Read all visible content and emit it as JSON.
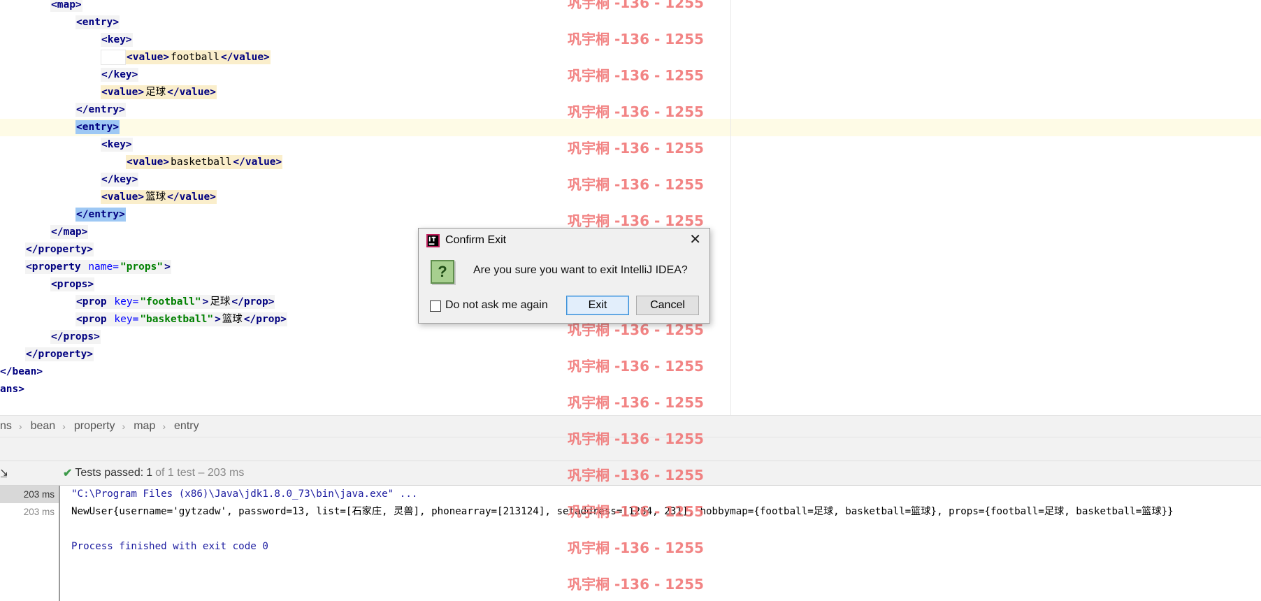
{
  "editor": {
    "lines": [
      {
        "indent": 72,
        "tokens": [
          [
            "bl hl-tag",
            "<map>"
          ]
        ]
      },
      {
        "indent": 108,
        "tokens": [
          [
            "bl hl-tag",
            "<entry>"
          ]
        ]
      },
      {
        "indent": 144,
        "tokens": [
          [
            "bl hl-tag",
            "<key>"
          ]
        ]
      },
      {
        "indent": 180,
        "pre": "white-block",
        "tokens": [
          [
            "hl-val",
            "<value>",
            "bl"
          ],
          [
            "hl-val",
            "football",
            "tx"
          ],
          [
            "hl-val",
            "</value>",
            "bl"
          ]
        ]
      },
      {
        "indent": 144,
        "tokens": [
          [
            "bl hl-tag",
            "</key>"
          ]
        ]
      },
      {
        "indent": 144,
        "tokens": [
          [
            "hl-val",
            "<value>",
            "bl"
          ],
          [
            "hl-val",
            "足球",
            "tx"
          ],
          [
            "hl-val",
            "</value>",
            "bl"
          ]
        ]
      },
      {
        "indent": 108,
        "tokens": [
          [
            "bl hl-tag",
            "</entry>"
          ]
        ]
      },
      {
        "indent": 108,
        "caret": true,
        "tokens": [
          [
            "bl hl-sel",
            "<entry>"
          ]
        ]
      },
      {
        "indent": 144,
        "tokens": [
          [
            "bl hl-tag",
            "<key>"
          ]
        ]
      },
      {
        "indent": 180,
        "tokens": [
          [
            "hl-val",
            "<value>",
            "bl"
          ],
          [
            "hl-val",
            "basketball",
            "tx"
          ],
          [
            "hl-val",
            "</value>",
            "bl"
          ]
        ]
      },
      {
        "indent": 144,
        "tokens": [
          [
            "bl hl-tag",
            "</key>"
          ]
        ]
      },
      {
        "indent": 144,
        "tokens": [
          [
            "hl-val",
            "<value>",
            "bl"
          ],
          [
            "hl-val",
            "篮球",
            "tx"
          ],
          [
            "hl-val",
            "</value>",
            "bl"
          ]
        ]
      },
      {
        "indent": 108,
        "tokens": [
          [
            "bl hl-sel",
            "</entry>"
          ]
        ]
      },
      {
        "indent": 72,
        "tokens": [
          [
            "bl hl-tag",
            "</map>"
          ]
        ]
      },
      {
        "indent": 36,
        "tokens": [
          [
            "bl hl-tag",
            "</property>"
          ]
        ]
      },
      {
        "indent": 36,
        "tokens": [
          [
            "bl hl-tag",
            "<property "
          ],
          [
            "at hl-tag",
            "name="
          ],
          [
            "vl hl-tag",
            "\"props\""
          ],
          [
            "bl hl-tag",
            ">"
          ]
        ]
      },
      {
        "indent": 72,
        "tokens": [
          [
            "bl hl-tag",
            "<props>"
          ]
        ]
      },
      {
        "indent": 108,
        "tokens": [
          [
            "bl hl-tag",
            "<prop "
          ],
          [
            "at hl-tag",
            "key="
          ],
          [
            "vl hl-tag",
            "\"football\""
          ],
          [
            "bl hl-tag",
            ">"
          ],
          [
            "tx hl-tag",
            "足球"
          ],
          [
            "bl hl-tag",
            "</prop>"
          ]
        ]
      },
      {
        "indent": 108,
        "tokens": [
          [
            "bl hl-tag",
            "<prop "
          ],
          [
            "at hl-tag",
            "key="
          ],
          [
            "vl hl-tag",
            "\"basketball\""
          ],
          [
            "bl hl-tag",
            ">"
          ],
          [
            "tx hl-tag",
            "篮球"
          ],
          [
            "bl hl-tag",
            "</prop>"
          ]
        ]
      },
      {
        "indent": 72,
        "tokens": [
          [
            "bl hl-tag",
            "</props>"
          ]
        ]
      },
      {
        "indent": 36,
        "tokens": [
          [
            "bl hl-tag",
            "</property>"
          ]
        ]
      },
      {
        "indent": 0,
        "tokens": [
          [
            "bl",
            "</bean>"
          ]
        ]
      },
      {
        "indent": 0,
        "tokens": [
          [
            "bl",
            "ans>"
          ]
        ]
      }
    ]
  },
  "breadcrumb": {
    "items": [
      "ns",
      "bean",
      "property",
      "map",
      "entry"
    ]
  },
  "run": {
    "status_prefix": "Tests passed:",
    "status_count": "1",
    "status_suffix": "of 1 test – 203 ms",
    "times": [
      "203 ms",
      "203 ms"
    ],
    "console": [
      {
        "cls": "con-cmd",
        "text": "\"C:\\Program Files (x86)\\Java\\jdk1.8.0_73\\bin\\java.exe\" ..."
      },
      {
        "cls": "con-out",
        "text": "NewUser{username='gytzadw', password=13, list=[石家庄, 灵兽], phonearray=[213124], setaddress=[1234, 231], hobbymap={football=足球, basketball=篮球}, props={football=足球, basketball=篮球}}"
      },
      {
        "cls": "con-out",
        "text": ""
      },
      {
        "cls": "con-exit",
        "text": "Process finished with exit code 0"
      }
    ]
  },
  "dialog": {
    "title": "Confirm Exit",
    "message": "Are you sure you want to exit IntelliJ IDEA?",
    "checkbox_label": "Do not ask me again",
    "exit_label": "Exit",
    "cancel_label": "Cancel",
    "close_glyph": "✕",
    "question_glyph": "?"
  },
  "watermark": {
    "text": "巩宇桐 -136 - 1255",
    "color": "#f06e6e"
  }
}
